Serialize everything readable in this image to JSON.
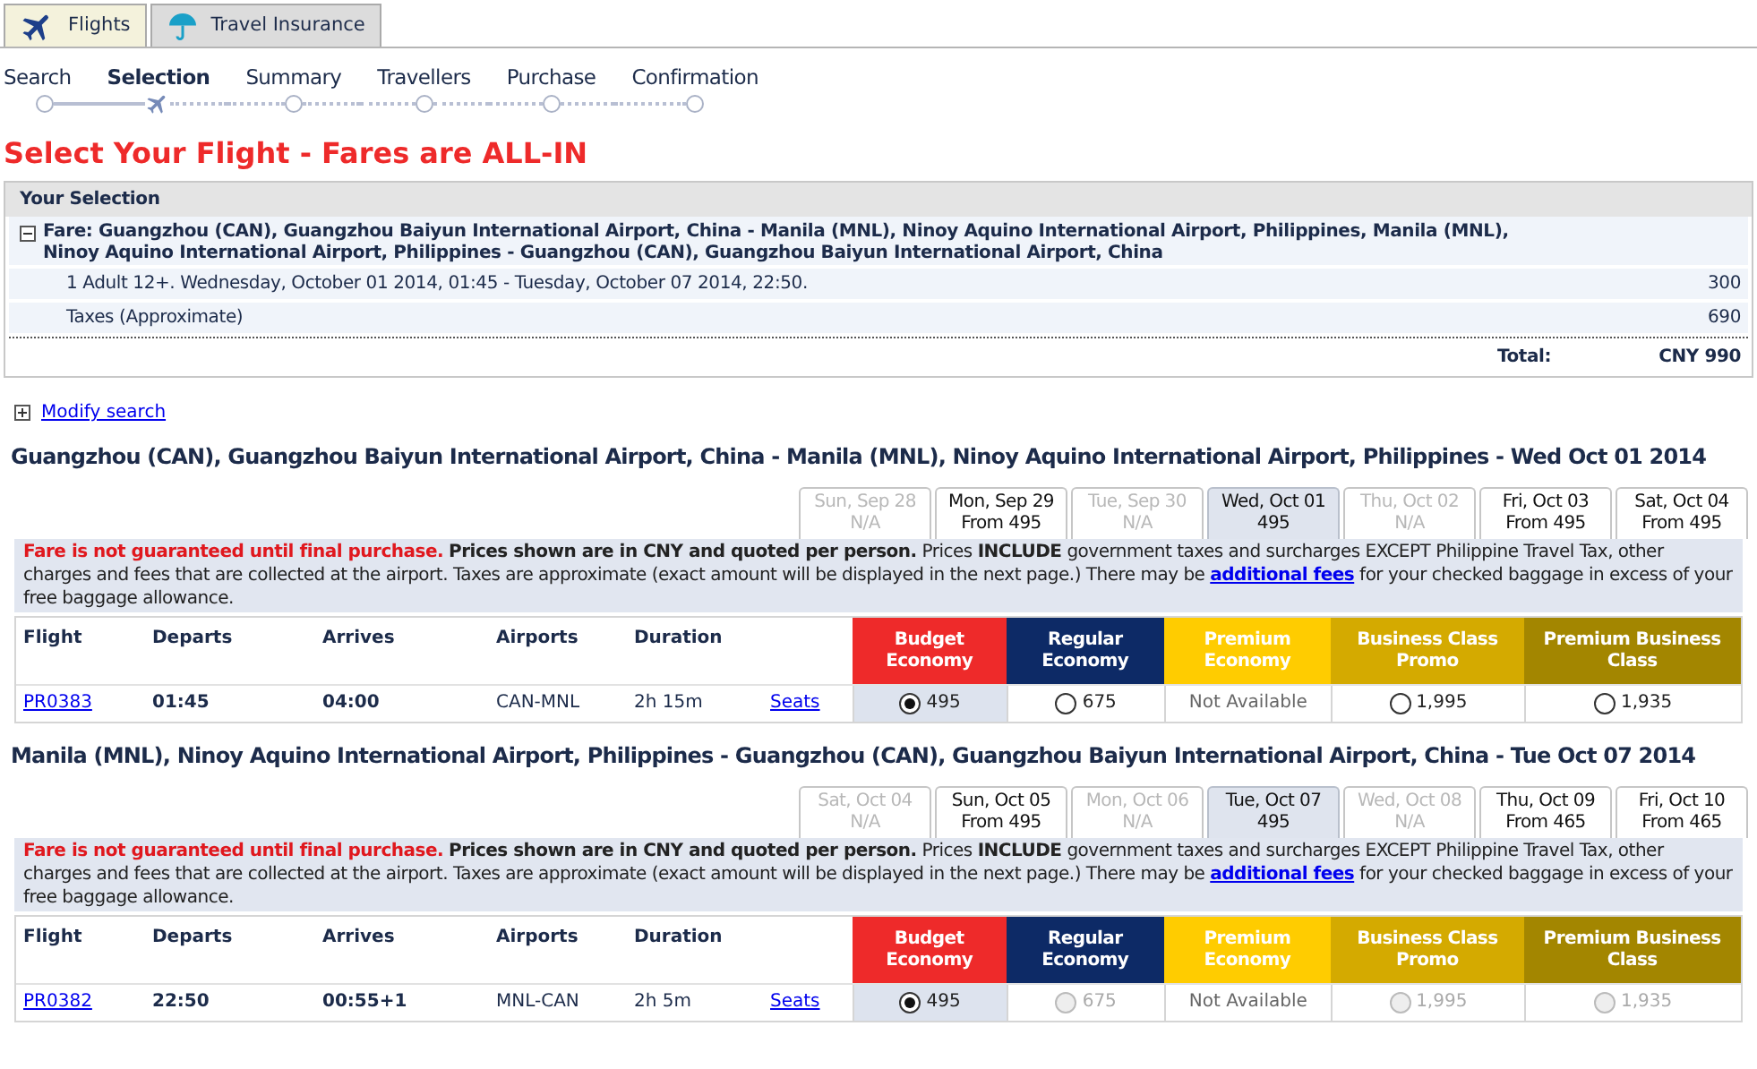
{
  "tabs": [
    {
      "label": "Flights",
      "selected": true,
      "kind": "plane"
    },
    {
      "label": "Travel Insurance",
      "selected": false,
      "kind": "umbrella"
    }
  ],
  "steps": [
    {
      "label": "Search",
      "selected": false
    },
    {
      "label": "Selection",
      "selected": true
    },
    {
      "label": "Summary",
      "selected": false
    },
    {
      "label": "Travellers",
      "selected": false
    },
    {
      "label": "Purchase",
      "selected": false
    },
    {
      "label": "Confirmation",
      "selected": false
    }
  ],
  "page_title": "Select Your Flight - Fares are ALL-IN",
  "your_selection": {
    "title": "Your Selection",
    "expanded": true,
    "fare": "Fare: Guangzhou (CAN), Guangzhou Baiyun International Airport, China - Manila (MNL), Ninoy Aquino International Airport, Philippines, Manila (MNL), Ninoy Aquino International Airport, Philippines - Guangzhou (CAN), Guangzhou Baiyun International Airport, China",
    "lines": [
      {
        "label": "1 Adult 12+. Wednesday, October 01 2014, 01:45 - Tuesday, October 07 2014, 22:50.",
        "amount": "300"
      },
      {
        "label": "Taxes (Approximate)",
        "amount": "690"
      }
    ],
    "total_label": "Total:",
    "total": "CNY 990"
  },
  "modify_search": {
    "label": "Modify search",
    "expanded": false
  },
  "legs": [
    {
      "heading": "Guangzhou (CAN), Guangzhou Baiyun International Airport, China - Manila (MNL), Ninoy Aquino International Airport, Philippines - Wed Oct 01 2014",
      "dates": [
        {
          "day": "Sun, Sep 28",
          "price": "N/A",
          "disabled": true,
          "selected": false
        },
        {
          "day": "Mon, Sep 29",
          "price": "From 495",
          "disabled": false,
          "selected": false
        },
        {
          "day": "Tue, Sep 30",
          "price": "N/A",
          "disabled": true,
          "selected": false
        },
        {
          "day": "Wed, Oct 01",
          "price": "495",
          "disabled": false,
          "selected": true
        },
        {
          "day": "Thu, Oct 02",
          "price": "N/A",
          "disabled": true,
          "selected": false
        },
        {
          "day": "Fri, Oct 03",
          "price": "From 495",
          "disabled": false,
          "selected": false
        },
        {
          "day": "Sat, Oct 04",
          "price": "From 495",
          "disabled": false,
          "selected": false
        }
      ],
      "notice": {
        "warning": "Fare is not guaranteed until final purchase.",
        "text": "**Prices shown are in CNY and quoted per person.** Prices **INCLUDE** government taxes and surcharges EXCEPT Philippine Travel Tax, other charges and fees that are collected at the airport. Taxes are approximate (exact amount will be displayed in the next page.) There may be",
        "link": "additional fees",
        "text_after": "for your checked baggage in excess of your free baggage allowance."
      },
      "columns": [
        "Flight",
        "Departs",
        "Arrives",
        "Airports",
        "Duration"
      ],
      "fare_classes": [
        {
          "name": "Budget Economy",
          "color": "#ee2a2a"
        },
        {
          "name": "Regular Economy",
          "color": "#0d2a66"
        },
        {
          "name": "Premium Economy",
          "color": "#ffcc00"
        },
        {
          "name": "Business Class Promo",
          "color": "#d4aa00"
        },
        {
          "name": "Premium Business Class",
          "color": "#a38600"
        }
      ],
      "flight": {
        "number": "PR0383",
        "departs": "01:45",
        "arrives": "04:00",
        "airports": "CAN-MNL",
        "duration": "2h 15m",
        "seats": "Seats"
      },
      "fares": [
        {
          "kind": "radio",
          "price": "495",
          "selected": true,
          "disabled": false
        },
        {
          "kind": "radio",
          "price": "675",
          "selected": false,
          "disabled": false
        },
        {
          "kind": "unavailable",
          "price": "Not Available"
        },
        {
          "kind": "radio",
          "price": "1,995",
          "selected": false,
          "disabled": false
        },
        {
          "kind": "radio",
          "price": "1,935",
          "selected": false,
          "disabled": false
        }
      ]
    },
    {
      "heading": "Manila (MNL), Ninoy Aquino International Airport, Philippines - Guangzhou (CAN), Guangzhou Baiyun International Airport, China - Tue Oct 07 2014",
      "dates": [
        {
          "day": "Sat, Oct 04",
          "price": "N/A",
          "disabled": true,
          "selected": false
        },
        {
          "day": "Sun, Oct 05",
          "price": "From 495",
          "disabled": false,
          "selected": false
        },
        {
          "day": "Mon, Oct 06",
          "price": "N/A",
          "disabled": true,
          "selected": false
        },
        {
          "day": "Tue, Oct 07",
          "price": "495",
          "disabled": false,
          "selected": true
        },
        {
          "day": "Wed, Oct 08",
          "price": "N/A",
          "disabled": true,
          "selected": false
        },
        {
          "day": "Thu, Oct 09",
          "price": "From 465",
          "disabled": false,
          "selected": false
        },
        {
          "day": "Fri, Oct 10",
          "price": "From 465",
          "disabled": false,
          "selected": false
        }
      ],
      "notice": {
        "warning": "Fare is not guaranteed until final purchase.",
        "text": "**Prices shown are in CNY and quoted per person.** Prices **INCLUDE** government taxes and surcharges EXCEPT Philippine Travel Tax, other charges and fees that are collected at the airport. Taxes are approximate (exact amount will be displayed in the next page.) There may be",
        "link": "additional fees",
        "text_after": "for your checked baggage in excess of your free baggage allowance."
      },
      "columns": [
        "Flight",
        "Departs",
        "Arrives",
        "Airports",
        "Duration"
      ],
      "fare_classes": [
        {
          "name": "Budget Economy",
          "color": "#ee2a2a"
        },
        {
          "name": "Regular Economy",
          "color": "#0d2a66"
        },
        {
          "name": "Premium Economy",
          "color": "#ffcc00"
        },
        {
          "name": "Business Class Promo",
          "color": "#d4aa00"
        },
        {
          "name": "Premium Business Class",
          "color": "#a38600"
        }
      ],
      "flight": {
        "number": "PR0382",
        "departs": "22:50",
        "arrives": "00:55+1",
        "airports": "MNL-CAN",
        "duration": "2h 5m",
        "seats": "Seats"
      },
      "fares": [
        {
          "kind": "radio",
          "price": "495",
          "selected": true,
          "disabled": false
        },
        {
          "kind": "radio",
          "price": "675",
          "selected": false,
          "disabled": true
        },
        {
          "kind": "unavailable",
          "price": "Not Available"
        },
        {
          "kind": "radio",
          "price": "1,995",
          "selected": false,
          "disabled": true
        },
        {
          "kind": "radio",
          "price": "1,935",
          "selected": false,
          "disabled": true
        }
      ]
    }
  ]
}
